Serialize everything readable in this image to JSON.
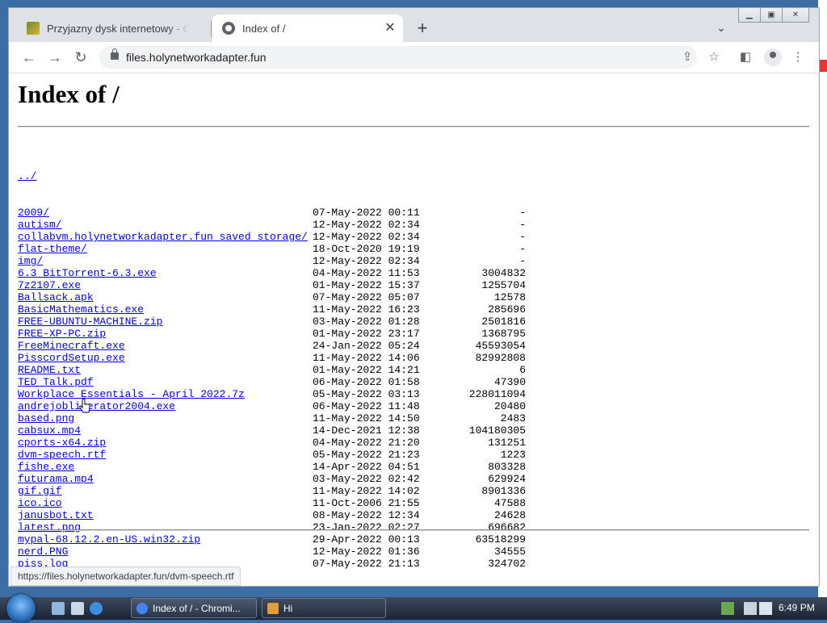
{
  "tabs": [
    {
      "title": "Przyjazny dysk internetowy - Cho",
      "favicon": "site-favicon",
      "active": false
    },
    {
      "title": "Index of /",
      "favicon": "globe-icon",
      "active": true
    }
  ],
  "toolbar": {
    "url": "files.holynetworkadapter.fun"
  },
  "page": {
    "heading": "Index of /",
    "parent_link": "../",
    "entries": [
      {
        "name": "2009/",
        "date": "07-May-2022 00:11",
        "size": "-"
      },
      {
        "name": "autism/",
        "date": "12-May-2022 02:34",
        "size": "-"
      },
      {
        "name": "collabvm.holynetworkadapter.fun saved storage/",
        "date": "12-May-2022 02:34",
        "size": "-"
      },
      {
        "name": "flat-theme/",
        "date": "18-Oct-2020 19:19",
        "size": "-"
      },
      {
        "name": "img/",
        "date": "12-May-2022 02:34",
        "size": "-"
      },
      {
        "name": "6.3_BitTorrent-6.3.exe",
        "date": "04-May-2022 11:53",
        "size": "3004832"
      },
      {
        "name": "7z2107.exe",
        "date": "01-May-2022 15:37",
        "size": "1255704"
      },
      {
        "name": "Ballsack.apk",
        "date": "07-May-2022 05:07",
        "size": "12578"
      },
      {
        "name": "BasicMathematics.exe",
        "date": "11-May-2022 16:23",
        "size": "285696"
      },
      {
        "name": "FREE-UBUNTU-MACHINE.zip",
        "date": "03-May-2022 01:28",
        "size": "2501816"
      },
      {
        "name": "FREE-XP-PC.zip",
        "date": "01-May-2022 23:17",
        "size": "1368795"
      },
      {
        "name": "FreeMinecraft.exe",
        "date": "24-Jan-2022 05:24",
        "size": "45593054"
      },
      {
        "name": "PisscordSetup.exe",
        "date": "11-May-2022 14:06",
        "size": "82992808"
      },
      {
        "name": "README.txt",
        "date": "01-May-2022 14:21",
        "size": "6"
      },
      {
        "name": "TED_Talk.pdf",
        "date": "06-May-2022 01:58",
        "size": "47390"
      },
      {
        "name": "Workplace Essentials - April 2022.7z",
        "date": "05-May-2022 03:13",
        "size": "228011094"
      },
      {
        "name": "andrejobliterator2004.exe",
        "date": "06-May-2022 11:48",
        "size": "20480"
      },
      {
        "name": "based.png",
        "date": "11-May-2022 14:50",
        "size": "2483"
      },
      {
        "name": "cabsux.mp4",
        "date": "14-Dec-2021 12:38",
        "size": "104180305"
      },
      {
        "name": "cports-x64.zip",
        "date": "04-May-2022 21:20",
        "size": "131251"
      },
      {
        "name": "dvm-speech.rtf",
        "date": "05-May-2022 21:23",
        "size": "1223"
      },
      {
        "name": "fishe.exe",
        "date": "14-Apr-2022 04:51",
        "size": "803328"
      },
      {
        "name": "futurama.mp4",
        "date": "03-May-2022 02:42",
        "size": "629924"
      },
      {
        "name": "gif.gif",
        "date": "11-May-2022 14:02",
        "size": "8901336"
      },
      {
        "name": "ico.ico",
        "date": "11-Oct-2006 21:55",
        "size": "47588"
      },
      {
        "name": "janusbot.txt",
        "date": "08-May-2022 12:34",
        "size": "24628"
      },
      {
        "name": "latest.png",
        "date": "23-Jan-2022 02:27",
        "size": "696682"
      },
      {
        "name": "mypal-68.12.2.en-US.win32.zip",
        "date": "29-Apr-2022 00:13",
        "size": "63518299"
      },
      {
        "name": "nerd.PNG",
        "date": "12-May-2022 01:36",
        "size": "34555"
      },
      {
        "name": "piss.log",
        "date": "07-May-2022 21:13",
        "size": "324702"
      }
    ]
  },
  "status_url": "https://files.holynetworkadapter.fun/dvm-speech.rtf",
  "taskbar": {
    "tasks": [
      {
        "label": "Index of / - Chromi...",
        "icon": "chromium-icon"
      },
      {
        "label": "Hi",
        "icon": "app-icon"
      }
    ],
    "clock": "6:49 PM"
  }
}
